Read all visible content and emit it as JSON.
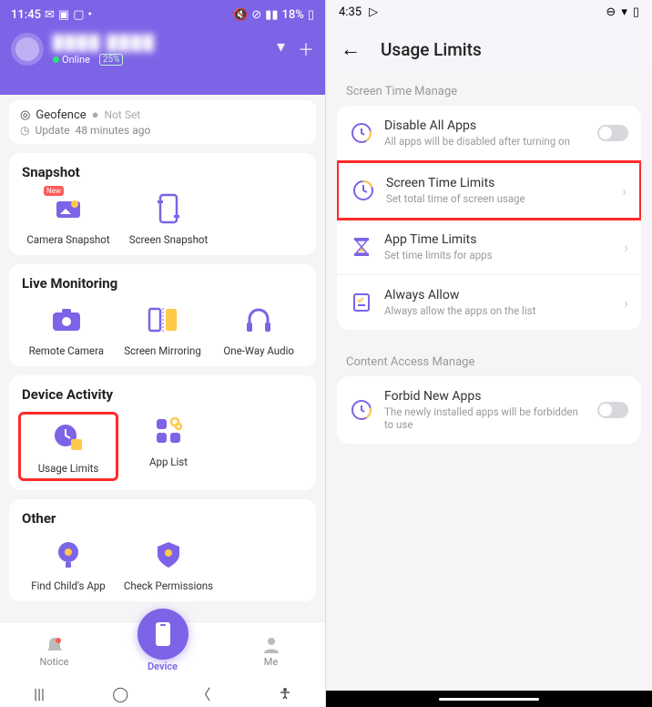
{
  "left": {
    "status": {
      "time": "11:45",
      "battery_text": "18%"
    },
    "profile": {
      "name": "████ ████",
      "online": "Online",
      "battery": "25%"
    },
    "geofence": {
      "label": "Geofence",
      "value": "Not Set"
    },
    "update": {
      "label": "Update",
      "value": "48 minutes ago"
    },
    "sections": {
      "snapshot": {
        "title": "Snapshot",
        "items": {
          "camera": "Camera Snapshot",
          "screen": "Screen Snapshot"
        }
      },
      "live": {
        "title": "Live Monitoring",
        "items": {
          "camera": "Remote Camera",
          "mirror": "Screen Mirroring",
          "audio": "One-Way Audio"
        }
      },
      "activity": {
        "title": "Device Activity",
        "items": {
          "usage": "Usage Limits",
          "applist": "App List"
        }
      },
      "other": {
        "title": "Other",
        "items": {
          "find": "Find Child's App",
          "perm": "Check Permissions"
        }
      }
    },
    "nav": {
      "notice": "Notice",
      "device": "Device",
      "me": "Me"
    }
  },
  "right": {
    "status": {
      "time": "4:35"
    },
    "title": "Usage Limits",
    "section1": "Screen Time Manage",
    "section2": "Content Access Manage",
    "items": {
      "disable": {
        "title": "Disable All Apps",
        "sub": "All apps will be disabled after turning on"
      },
      "screentime": {
        "title": "Screen Time Limits",
        "sub": "Set total time of screen usage"
      },
      "apptime": {
        "title": "App Time Limits",
        "sub": "Set time limits for apps"
      },
      "always": {
        "title": "Always Allow",
        "sub": "Always allow the apps on the list"
      },
      "forbid": {
        "title": "Forbid New Apps",
        "sub": "The newly installed apps will be forbidden to use"
      }
    }
  },
  "colors": {
    "accent": "#7d63e6",
    "highlight": "#ff2a2a"
  }
}
